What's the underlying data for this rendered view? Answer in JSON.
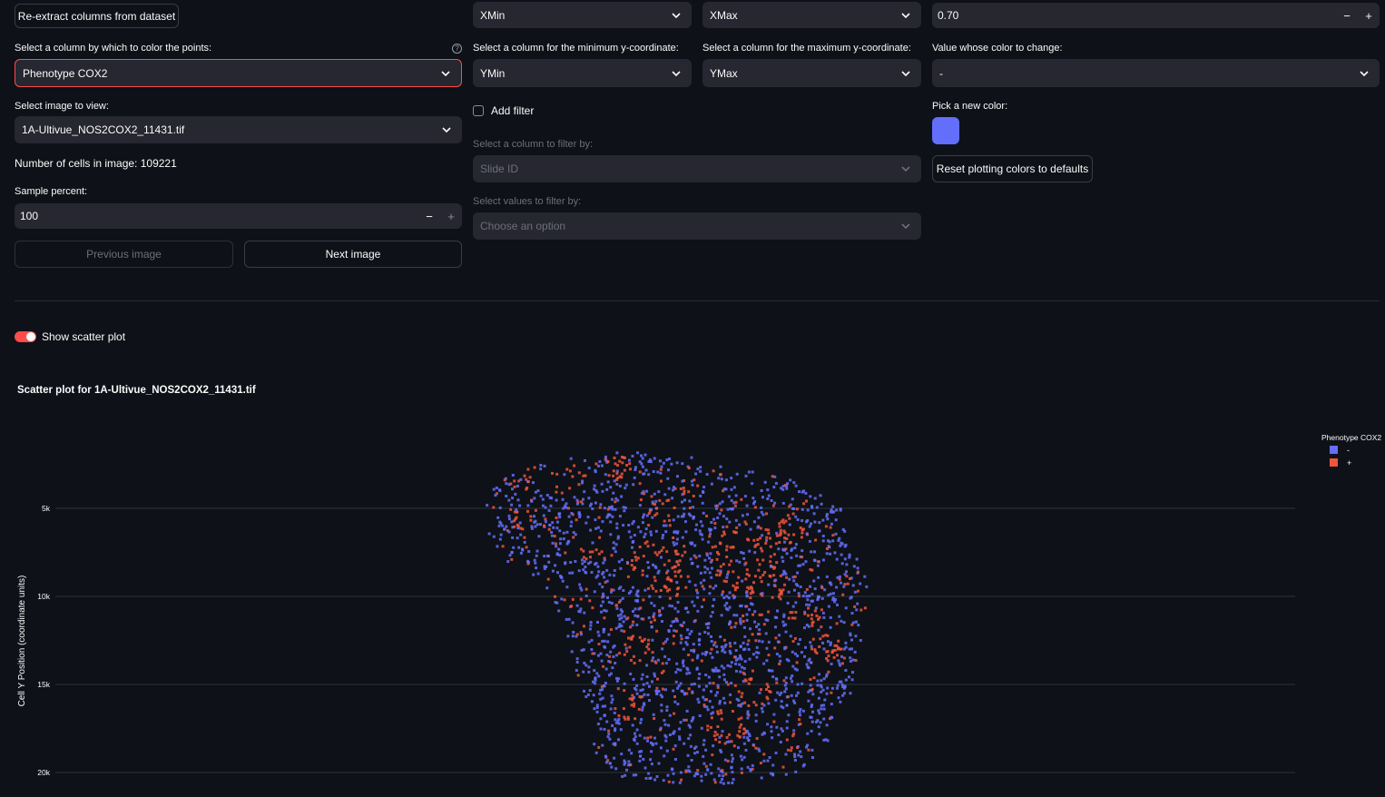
{
  "col1": {
    "reextract_label": "Re-extract columns from dataset",
    "color_by_label": "Select a column by which to color the points:",
    "color_by_value": "Phenotype COX2",
    "image_label": "Select image to view:",
    "image_value": "1A-Ultivue_NOS2COX2_11431.tif",
    "cell_count_text": "Number of cells in image: 109221",
    "sample_label": "Sample percent:",
    "sample_value": "100",
    "prev_label": "Previous image",
    "next_label": "Next image"
  },
  "col2": {
    "xmin_value": "XMin",
    "ymin_label": "Select a column for the minimum y-coordinate:",
    "ymin_value": "YMin",
    "add_filter_label": "Add filter",
    "filter_col_label": "Select a column to filter by:",
    "filter_col_value": "Slide ID",
    "filter_vals_label": "Select values to filter by:",
    "filter_vals_placeholder": "Choose an option"
  },
  "col3": {
    "xmax_value": "XMax",
    "ymax_label": "Select a column for the maximum y-coordinate:",
    "ymax_value": "YMax"
  },
  "col4": {
    "opacity_value": "0.70",
    "value_change_label": "Value whose color to change:",
    "value_change_value": "-",
    "pick_color_label": "Pick a new color:",
    "picked_color": "#636efa",
    "reset_label": "Reset plotting colors to defaults"
  },
  "toggle": {
    "label": "Show scatter plot",
    "on": true
  },
  "plot": {
    "title": "Scatter plot for 1A-Ultivue_NOS2COX2_11431.tif",
    "legend_title": "Phenotype COX2"
  },
  "chart_data": {
    "type": "scatter",
    "title": "Scatter plot for 1A-Ultivue_NOS2COX2_11431.tif",
    "ylabel": "Cell Y Position (coordinate units)",
    "yaxis_reversed": true,
    "y_ticks": [
      "5k",
      "10k",
      "15k",
      "20k"
    ],
    "y_tick_values": [
      5000,
      10000,
      15000,
      20000
    ],
    "legend_title": "Phenotype COX2",
    "series": [
      {
        "name": "-",
        "color": "#636efa"
      },
      {
        "name": "+",
        "color": "#ef553b"
      }
    ],
    "n_points": 109221,
    "grid": true
  }
}
